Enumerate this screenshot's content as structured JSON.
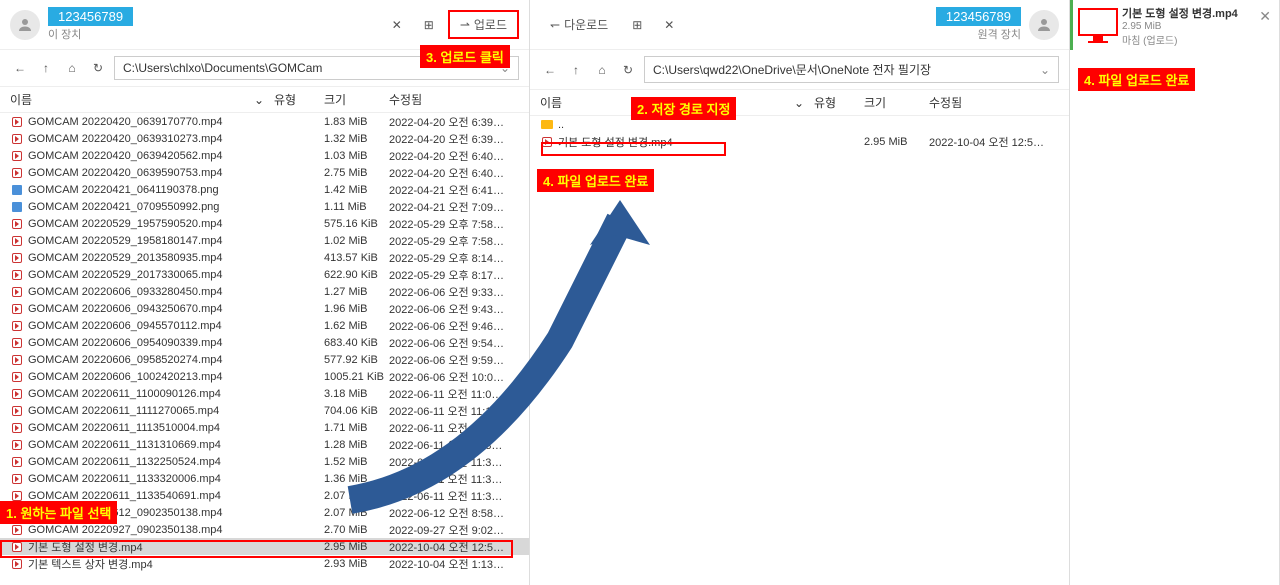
{
  "left": {
    "device_id": "123456789",
    "device_label": "이 장치",
    "upload_label": "업로드",
    "path": "C:\\Users\\chlxo\\Documents\\GOMCam",
    "columns": {
      "name": "이름",
      "type": "유형",
      "size": "크기",
      "modified": "수정됨"
    },
    "files": [
      {
        "name": "GOMCAM 20220420_0639170770.mp4",
        "size": "1.83 MiB",
        "date": "2022-04-20 오전 6:39…",
        "icon": "video"
      },
      {
        "name": "GOMCAM 20220420_0639310273.mp4",
        "size": "1.32 MiB",
        "date": "2022-04-20 오전 6:39…",
        "icon": "video"
      },
      {
        "name": "GOMCAM 20220420_0639420562.mp4",
        "size": "1.03 MiB",
        "date": "2022-04-20 오전 6:40…",
        "icon": "video"
      },
      {
        "name": "GOMCAM 20220420_0639590753.mp4",
        "size": "2.75 MiB",
        "date": "2022-04-20 오전 6:40…",
        "icon": "video"
      },
      {
        "name": "GOMCAM 20220421_0641190378.png",
        "size": "1.42 MiB",
        "date": "2022-04-21 오전 6:41…",
        "icon": "img"
      },
      {
        "name": "GOMCAM 20220421_0709550992.png",
        "size": "1.11 MiB",
        "date": "2022-04-21 오전 7:09…",
        "icon": "img"
      },
      {
        "name": "GOMCAM 20220529_1957590520.mp4",
        "size": "575.16 KiB",
        "date": "2022-05-29 오후 7:58…",
        "icon": "video"
      },
      {
        "name": "GOMCAM 20220529_1958180147.mp4",
        "size": "1.02 MiB",
        "date": "2022-05-29 오후 7:58…",
        "icon": "video"
      },
      {
        "name": "GOMCAM 20220529_2013580935.mp4",
        "size": "413.57 KiB",
        "date": "2022-05-29 오후 8:14…",
        "icon": "video"
      },
      {
        "name": "GOMCAM 20220529_2017330065.mp4",
        "size": "622.90 KiB",
        "date": "2022-05-29 오후 8:17…",
        "icon": "video"
      },
      {
        "name": "GOMCAM 20220606_0933280450.mp4",
        "size": "1.27 MiB",
        "date": "2022-06-06 오전 9:33…",
        "icon": "video"
      },
      {
        "name": "GOMCAM 20220606_0943250670.mp4",
        "size": "1.96 MiB",
        "date": "2022-06-06 오전 9:43…",
        "icon": "video"
      },
      {
        "name": "GOMCAM 20220606_0945570112.mp4",
        "size": "1.62 MiB",
        "date": "2022-06-06 오전 9:46…",
        "icon": "video"
      },
      {
        "name": "GOMCAM 20220606_0954090339.mp4",
        "size": "683.40 KiB",
        "date": "2022-06-06 오전 9:54…",
        "icon": "video"
      },
      {
        "name": "GOMCAM 20220606_0958520274.mp4",
        "size": "577.92 KiB",
        "date": "2022-06-06 오전 9:59…",
        "icon": "video"
      },
      {
        "name": "GOMCAM 20220606_1002420213.mp4",
        "size": "1005.21 KiB",
        "date": "2022-06-06 오전 10:0…",
        "icon": "video"
      },
      {
        "name": "GOMCAM 20220611_1100090126.mp4",
        "size": "3.18 MiB",
        "date": "2022-06-11 오전 11:0…",
        "icon": "video"
      },
      {
        "name": "GOMCAM 20220611_1111270065.mp4",
        "size": "704.06 KiB",
        "date": "2022-06-11 오전 11:1…",
        "icon": "video"
      },
      {
        "name": "GOMCAM 20220611_1113510004.mp4",
        "size": "1.71 MiB",
        "date": "2022-06-11 오전 11:1…",
        "icon": "video"
      },
      {
        "name": "GOMCAM 20220611_1131310669.mp4",
        "size": "1.28 MiB",
        "date": "2022-06-11 오전 11:3…",
        "icon": "video"
      },
      {
        "name": "GOMCAM 20220611_1132250524.mp4",
        "size": "1.52 MiB",
        "date": "2022-06-11 오전 11:3…",
        "icon": "video"
      },
      {
        "name": "GOMCAM 20220611_1133320006.mp4",
        "size": "1.36 MiB",
        "date": "2022-06-11 오전 11:3…",
        "icon": "video"
      },
      {
        "name": "GOMCAM 20220611_1133540691.mp4",
        "size": "2.07 MiB",
        "date": "2022-06-11 오전 11:3…",
        "icon": "video"
      },
      {
        "name": "GOMCAM 20220612_0902350138.mp4",
        "size": "2.07 MiB",
        "date": "2022-06-12 오전 8:58…",
        "icon": "video"
      },
      {
        "name": "GOMCAM 20220927_0902350138.mp4",
        "size": "2.70 MiB",
        "date": "2022-09-27 오전 9:02…",
        "icon": "video"
      },
      {
        "name": "기본 도형 설정 변경.mp4",
        "size": "2.95 MiB",
        "date": "2022-10-04 오전 12:5…",
        "icon": "video",
        "selected": true
      },
      {
        "name": "기본 텍스트 상자 변경.mp4",
        "size": "2.93 MiB",
        "date": "2022-10-04 오전 1:13…",
        "icon": "video"
      }
    ]
  },
  "right": {
    "device_id": "123456789",
    "device_label": "원격 장치",
    "download_label": "다운로드",
    "path": "C:\\Users\\qwd22\\OneDrive\\문서\\OneNote 전자 필기장",
    "columns": {
      "name": "이름",
      "type": "유형",
      "size": "크기",
      "modified": "수정됨"
    },
    "updir": "..",
    "files": [
      {
        "name": "기본 도형 설정 변경.mp4",
        "size": "2.95 MiB",
        "date": "2022-10-04 오전 12:5…",
        "icon": "video"
      }
    ]
  },
  "notification": {
    "title": "기본 도형 설정 변경.mp4",
    "size": "2.95 MiB",
    "status": "마침 (업로드)"
  },
  "annotations": {
    "a1": "1. 원하는 파일 선택",
    "a2": "2. 저장 경로 지정",
    "a3": "3. 업로드 클릭",
    "a4": "4. 파일 업로드 완료",
    "a5": "4. 파일 업로드 완료"
  }
}
